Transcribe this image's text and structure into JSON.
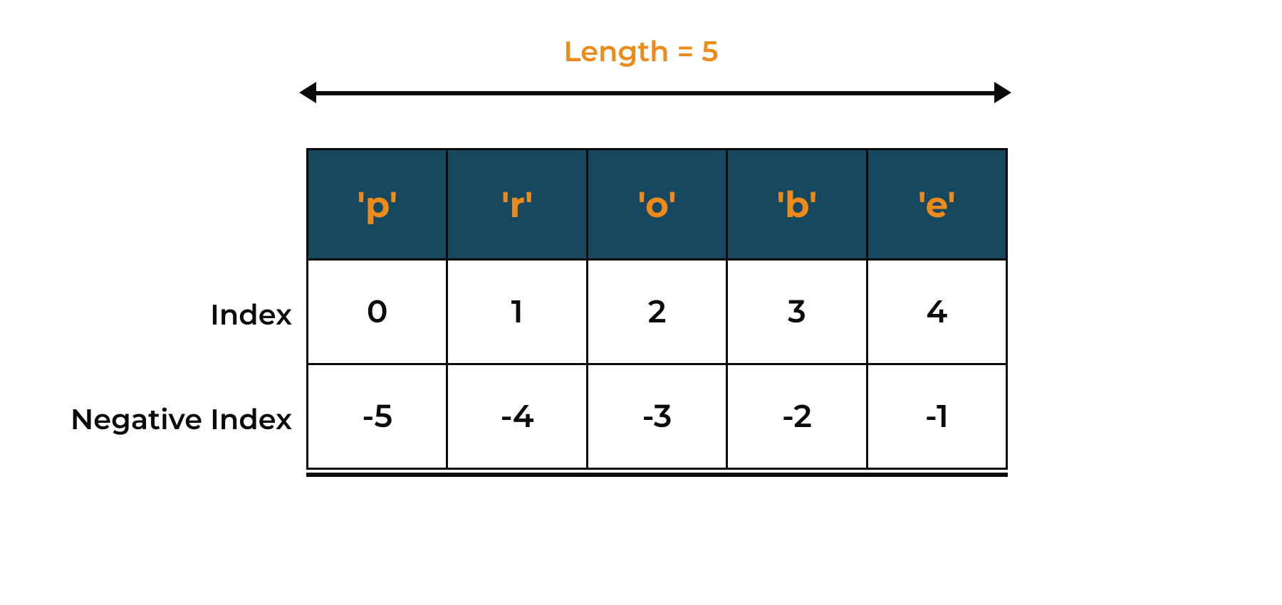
{
  "lengthLabel": "Length = 5",
  "labels": {
    "index": "Index",
    "negativeIndex": "Negative Index"
  },
  "chars": [
    "'p'",
    "'r'",
    "'o'",
    "'b'",
    "'e'"
  ],
  "indices": [
    "0",
    "1",
    "2",
    "3",
    "4"
  ],
  "negIndices": [
    "-5",
    "-4",
    "-3",
    "-2",
    "-1"
  ],
  "chart_data": {
    "type": "table",
    "title": "Length = 5",
    "columns": [
      "p",
      "r",
      "o",
      "b",
      "e"
    ],
    "rows": {
      "Index": [
        0,
        1,
        2,
        3,
        4
      ],
      "Negative Index": [
        -5,
        -4,
        -3,
        -2,
        -1
      ]
    },
    "length": 5
  }
}
